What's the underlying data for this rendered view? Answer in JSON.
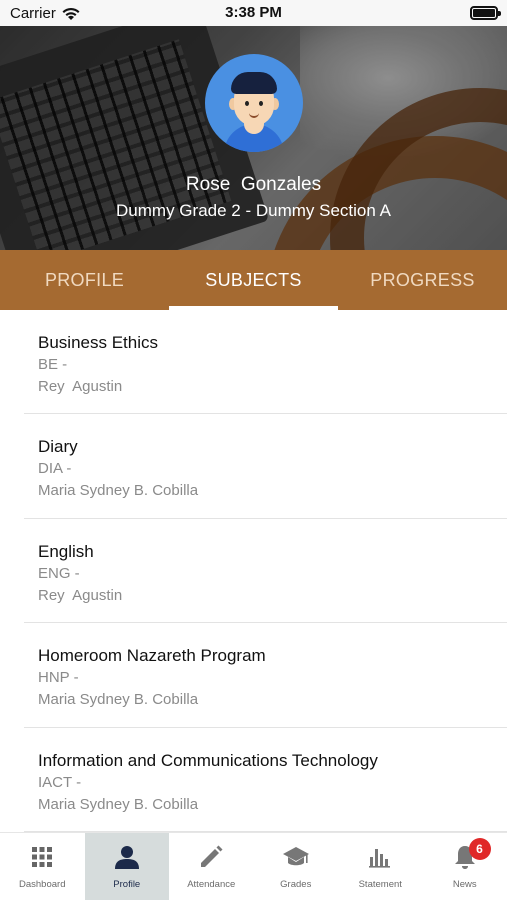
{
  "status_bar": {
    "carrier": "Carrier",
    "time": "3:38 PM"
  },
  "profile": {
    "name": "Rose  Gonzales",
    "class_section": "Dummy Grade 2 - Dummy Section A"
  },
  "tabs": [
    {
      "label": "PROFILE",
      "active": false
    },
    {
      "label": "SUBJECTS",
      "active": true
    },
    {
      "label": "PROGRESS",
      "active": false
    }
  ],
  "subjects": [
    {
      "title": "Business Ethics",
      "code": "BE -",
      "teacher": "Rey  Agustin"
    },
    {
      "title": "Diary",
      "code": "DIA -",
      "teacher": "Maria Sydney B. Cobilla"
    },
    {
      "title": "English",
      "code": "ENG -",
      "teacher": "Rey  Agustin"
    },
    {
      "title": "Homeroom Nazareth Program",
      "code": "HNP -",
      "teacher": "Maria Sydney B. Cobilla"
    },
    {
      "title": "Information and Communications Technology",
      "code": "IACT -",
      "teacher": "Maria Sydney B. Cobilla"
    }
  ],
  "bottom_nav": [
    {
      "label": "Dashboard",
      "icon": "grid-icon",
      "active": false
    },
    {
      "label": "Profile",
      "icon": "person-icon",
      "active": true
    },
    {
      "label": "Attendance",
      "icon": "pencil-icon",
      "active": false
    },
    {
      "label": "Grades",
      "icon": "graduation-cap-icon",
      "active": false
    },
    {
      "label": "Statement",
      "icon": "bar-chart-icon",
      "active": false
    },
    {
      "label": "News",
      "icon": "bell-icon",
      "active": false,
      "badge": "6"
    }
  ],
  "colors": {
    "tab_bar": "#a56a31",
    "active_nav_bg": "#d6dcdc",
    "badge": "#e02828",
    "avatar_bg": "#4a90e2"
  }
}
